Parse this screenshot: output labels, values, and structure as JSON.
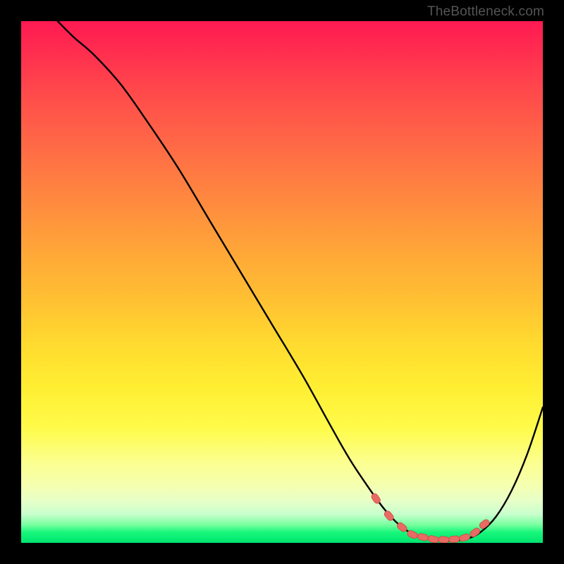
{
  "watermark": "TheBottleneck.com",
  "chart_data": {
    "type": "line",
    "title": "",
    "xlabel": "",
    "ylabel": "",
    "xlim": [
      0,
      100
    ],
    "ylim": [
      0,
      100
    ],
    "grid": false,
    "legend": false,
    "colors": {
      "gradient_top": "#ff1a52",
      "gradient_bottom": "#00e46f",
      "curve": "#000000",
      "markers_fill": "#e86b64",
      "markers_stroke": "#cc4a44"
    },
    "series": [
      {
        "name": "bottleneck-curve",
        "x": [
          7,
          10,
          14,
          19,
          24,
          30,
          36,
          42,
          48,
          54,
          59,
          63,
          67,
          70,
          73,
          75.5,
          78,
          80.5,
          83,
          85.5,
          88,
          91,
          94,
          97,
          100
        ],
        "y": [
          100,
          97,
          93.5,
          88,
          81,
          72,
          62,
          52,
          42,
          32,
          23,
          16,
          10,
          6,
          3,
          1.6,
          0.8,
          0.4,
          0.4,
          0.8,
          2,
          5,
          10,
          17,
          26
        ]
      }
    ],
    "markers": {
      "name": "trough-markers",
      "x": [
        68,
        70.5,
        73,
        75,
        77,
        79,
        81,
        83,
        85,
        87,
        88.8
      ],
      "y": [
        8.5,
        5.2,
        3.0,
        1.6,
        1.1,
        0.7,
        0.6,
        0.7,
        1.0,
        2.0,
        3.6
      ]
    }
  }
}
